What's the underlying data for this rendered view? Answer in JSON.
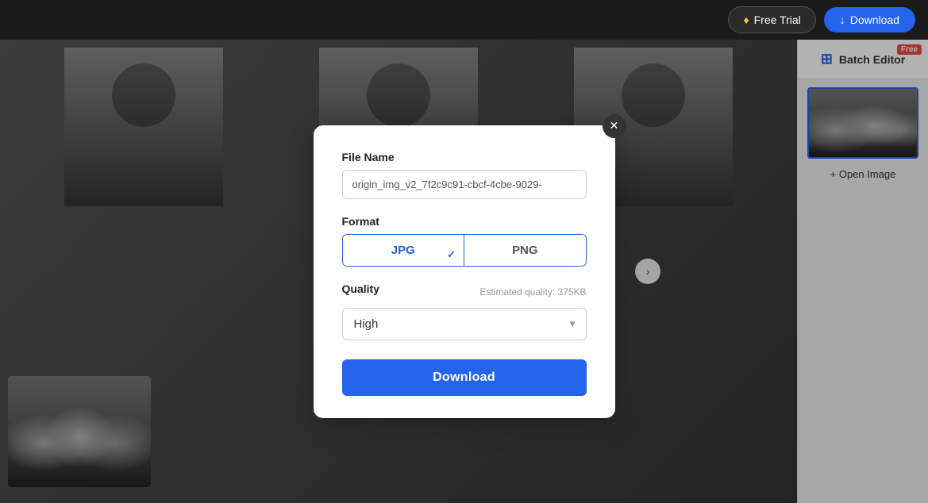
{
  "navbar": {
    "free_trial_label": "Free Trial",
    "download_label": "Download",
    "diamond_icon": "♦",
    "download_icon": "↓"
  },
  "sidebar": {
    "batch_editor_label": "Batch Editor",
    "free_badge": "Free",
    "open_image_label": "+ Open Image",
    "batch_icon": "▦"
  },
  "dialog": {
    "file_name_label": "File Name",
    "file_name_value": "origin_img_v2_7f2c9c91-cbcf-4cbe-9029-",
    "format_label": "Format",
    "jpg_label": "JPG",
    "png_label": "PNG",
    "quality_label": "Quality",
    "estimated_quality": "Estimated quality: 375KB",
    "quality_value": "High",
    "download_label": "Download",
    "close_icon": "✕"
  },
  "colors": {
    "accent": "#2563eb",
    "danger": "#e84b4b",
    "dark": "#1a1a1a"
  }
}
